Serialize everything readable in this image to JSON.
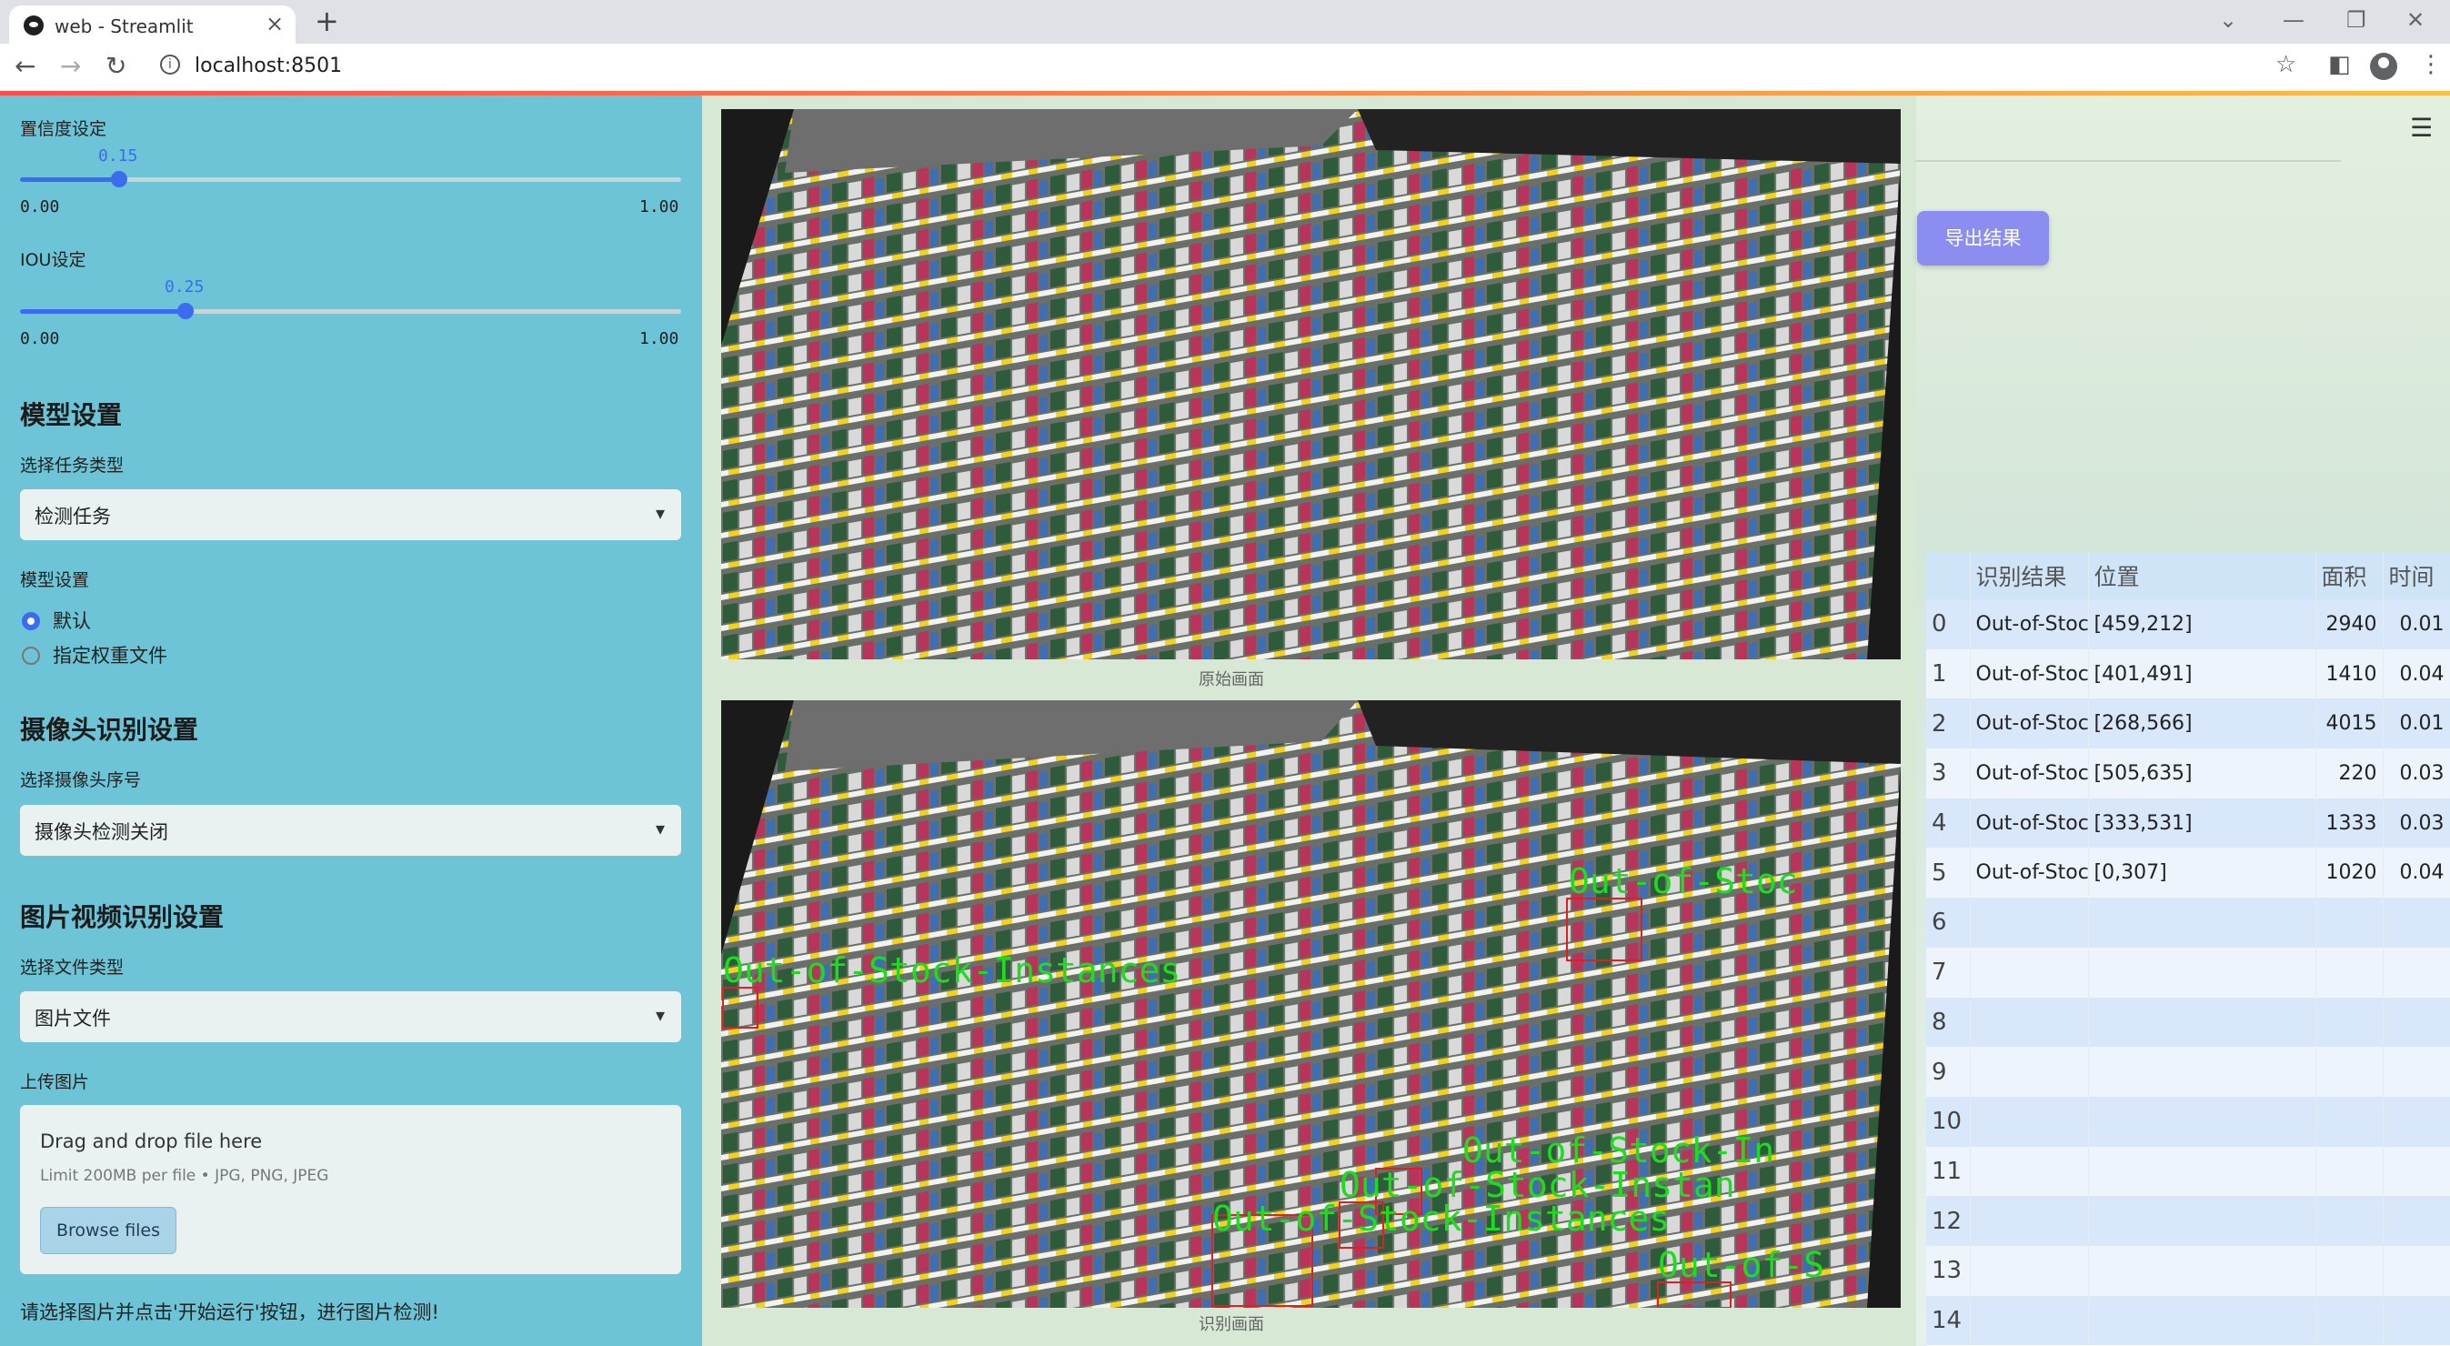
{
  "browser": {
    "tab_title": "web - Streamlit",
    "url": "localhost:8501"
  },
  "sidebar": {
    "confidence": {
      "label": "置信度设定",
      "value": "0.15",
      "value_fraction": 0.15,
      "min": "0.00",
      "max": "1.00"
    },
    "iou": {
      "label": "IOU设定",
      "value": "0.25",
      "value_fraction": 0.25,
      "min": "0.00",
      "max": "1.00"
    },
    "model_section": "模型设置",
    "task_type_label": "选择任务类型",
    "task_type_value": "检测任务",
    "model_settings_label": "模型设置",
    "model_options": [
      {
        "label": "默认",
        "selected": true
      },
      {
        "label": "指定权重文件",
        "selected": false
      }
    ],
    "camera_section": "摄像头识别设置",
    "camera_label": "选择摄像头序号",
    "camera_value": "摄像头检测关闭",
    "media_section": "图片视频识别设置",
    "file_type_label": "选择文件类型",
    "file_type_value": "图片文件",
    "upload_label": "上传图片",
    "upload_title": "Drag and drop file here",
    "upload_limit": "Limit 200MB per file • JPG, PNG, JPEG",
    "browse_button": "Browse files",
    "hint": "请选择图片并点击'开始运行'按钮，进行图片检测!"
  },
  "main": {
    "original_caption": "原始画面",
    "result_caption": "识别画面",
    "export_button": "导出结果",
    "detection_labels": [
      "Out-of-Stoc",
      "Out-of-Stock-Instances",
      "Out-of-Stock-In",
      "Out-of-Stock-Instan",
      "Out-of-Stock-Instances",
      "Out-of-S"
    ]
  },
  "results_table": {
    "headers": [
      "",
      "识别结果",
      "位置",
      "面积",
      "时间"
    ],
    "rows": [
      {
        "index": "0",
        "result": "Out-of-Stock-Instances",
        "position": "[459,212]",
        "area": "2940",
        "time": "0.01"
      },
      {
        "index": "1",
        "result": "Out-of-Stock-Instances",
        "position": "[401,491]",
        "area": "1410",
        "time": "0.04"
      },
      {
        "index": "2",
        "result": "Out-of-Stock-Instances",
        "position": "[268,566]",
        "area": "4015",
        "time": "0.01"
      },
      {
        "index": "3",
        "result": "Out-of-Stock-Instances",
        "position": "[505,635]",
        "area": "220",
        "time": "0.03"
      },
      {
        "index": "4",
        "result": "Out-of-Stock-Instances",
        "position": "[333,531]",
        "area": "1333",
        "time": "0.03"
      },
      {
        "index": "5",
        "result": "Out-of-Stock-Instances",
        "position": "[0,307]",
        "area": "1020",
        "time": "0.04"
      },
      {
        "index": "6",
        "result": "",
        "position": "",
        "area": "",
        "time": ""
      },
      {
        "index": "7",
        "result": "",
        "position": "",
        "area": "",
        "time": ""
      },
      {
        "index": "8",
        "result": "",
        "position": "",
        "area": "",
        "time": ""
      },
      {
        "index": "9",
        "result": "",
        "position": "",
        "area": "",
        "time": ""
      },
      {
        "index": "10",
        "result": "",
        "position": "",
        "area": "",
        "time": ""
      },
      {
        "index": "11",
        "result": "",
        "position": "",
        "area": "",
        "time": ""
      },
      {
        "index": "12",
        "result": "",
        "position": "",
        "area": "",
        "time": ""
      },
      {
        "index": "13",
        "result": "",
        "position": "",
        "area": "",
        "time": ""
      },
      {
        "index": "14",
        "result": "",
        "position": "",
        "area": "",
        "time": ""
      }
    ]
  },
  "colors": {
    "sidebar_bg": "#6cc4d6",
    "main_bg": "#d7e8d5",
    "accent": "#3b6cf0",
    "export_button": "#8c8df0",
    "detection_box": "#e02020",
    "detection_text": "#1edc1e"
  },
  "icons": [
    "streamlit-favicon",
    "close-icon",
    "plus-icon",
    "back-icon",
    "forward-icon",
    "reload-icon",
    "info-icon",
    "star-icon",
    "sidepanel-icon",
    "profile-icon",
    "kebab-icon",
    "hamburger-icon",
    "caret-down-icon"
  ]
}
